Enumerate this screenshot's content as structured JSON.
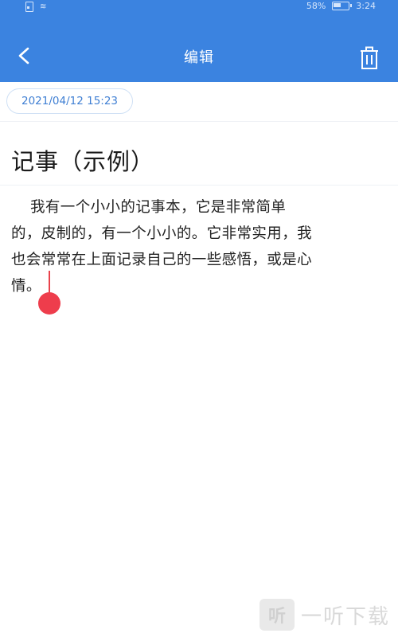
{
  "status_bar": {
    "battery_percent": "58%",
    "time": "3:24"
  },
  "header": {
    "title": "编辑",
    "back_icon": "chevron-left-icon",
    "delete_icon": "trash-icon"
  },
  "note": {
    "date": "2021/04/12 15:23",
    "title": "记事（示例）",
    "body_lines": [
      "我有一个小小的记事本，它是非常简单",
      "的，皮制的，有一个小小的。它非常实用，我",
      "也会常常在上面记录自己的一些感悟，或是心",
      "情。"
    ]
  },
  "watermark": {
    "text": "一听下载",
    "icon_glyph": "听"
  },
  "colors": {
    "header_bg": "#3b83e0",
    "date_text": "#3f7fd3",
    "cursor": "#ee3d4c"
  }
}
